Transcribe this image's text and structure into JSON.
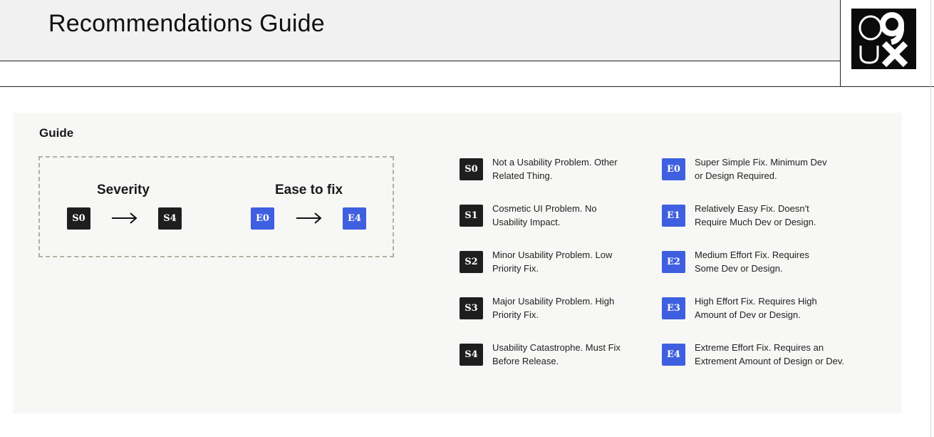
{
  "header": {
    "title": "Recommendations Guide"
  },
  "logo": {
    "glyphs": "09UX"
  },
  "guide": {
    "label": "Guide",
    "scale": {
      "severity_heading": "Severity",
      "severity_from": "S0",
      "severity_to": "S4",
      "ease_heading": "Ease to fix",
      "ease_from": "E0",
      "ease_to": "E4"
    },
    "severity": [
      {
        "code": "S0",
        "line1": "Not a Usability Problem. Other",
        "line2": "Related Thing."
      },
      {
        "code": "S1",
        "line1": "Cosmetic UI Problem. No",
        "line2": "Usability Impact."
      },
      {
        "code": "S2",
        "line1": "Minor Usability Problem. Low",
        "line2": "Priority Fix."
      },
      {
        "code": "S3",
        "line1": "Major Usability Problem. High",
        "line2": "Priority Fix."
      },
      {
        "code": "S4",
        "line1": "Usability Catastrophe. Must Fix",
        "line2": "Before Release."
      }
    ],
    "ease": [
      {
        "code": "E0",
        "line1": "Super Simple Fix. Minimum Dev",
        "line2": "or Design Required."
      },
      {
        "code": "E1",
        "line1": "Relatively Easy Fix. Doesn't",
        "line2": "Require Much Dev or Design."
      },
      {
        "code": "E2",
        "line1": "Medium Effort Fix. Requires",
        "line2": "Some Dev or Design."
      },
      {
        "code": "E3",
        "line1": "High Effort Fix. Requires High",
        "line2": "Amount of Dev or Design."
      },
      {
        "code": "E4",
        "line1": "Extreme Effort Fix. Requires an",
        "line2": "Extrement Amount of Design or Dev."
      }
    ]
  },
  "colors": {
    "dark_badge": "#1e1e1e",
    "blue_badge": "#3e5fe0",
    "dashed_border": "#b3b0a2"
  }
}
